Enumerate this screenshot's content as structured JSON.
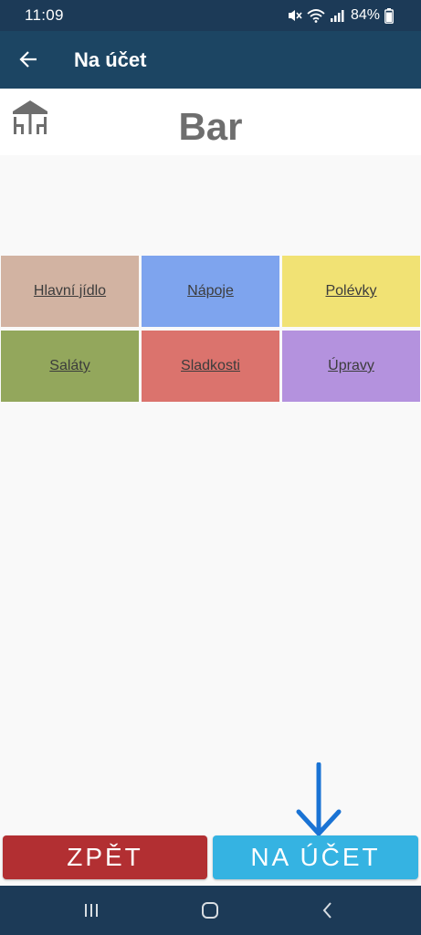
{
  "status_bar": {
    "time": "11:09",
    "battery": "84%"
  },
  "app_bar": {
    "title": "Na účet"
  },
  "header": {
    "location": "Bar"
  },
  "categories": [
    {
      "label": "Hlavní jídlo",
      "color": "#d2b3a2"
    },
    {
      "label": "Nápoje",
      "color": "#7ea4ee"
    },
    {
      "label": "Polévky",
      "color": "#f1e274"
    },
    {
      "label": "Saláty",
      "color": "#93a75c"
    },
    {
      "label": "Sladkosti",
      "color": "#db736d"
    },
    {
      "label": "Úpravy",
      "color": "#b492de"
    }
  ],
  "actions": {
    "back_label": "ZPĚT",
    "bill_label": "NA ÚČET"
  },
  "colors": {
    "status_bar": "#1c3a57",
    "app_bar": "#1c4563",
    "back_button": "#b22f32",
    "bill_button": "#35b3e2",
    "annotation_arrow": "#1a73d4"
  },
  "icons": {
    "status": [
      "mute-icon",
      "wifi-icon",
      "signal-icon",
      "battery-icon"
    ],
    "app_bar": "arrow-left-icon",
    "header": "table-chairs-icon",
    "navigation": [
      "recent-apps-icon",
      "home-icon",
      "back-icon"
    ]
  }
}
